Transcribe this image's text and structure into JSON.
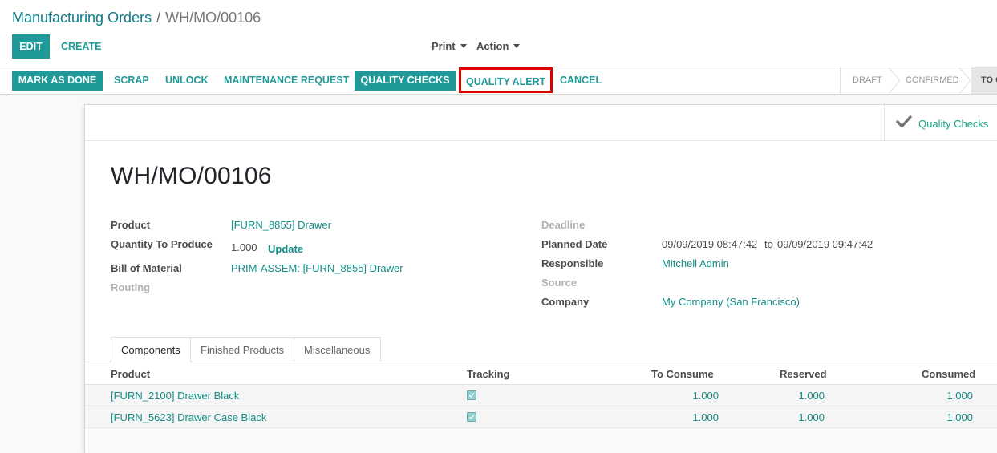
{
  "breadcrumb": {
    "parent": "Manufacturing Orders",
    "separator": "/",
    "current": "WH/MO/00106"
  },
  "toolbar": {
    "edit_label": "EDIT",
    "create_label": "CREATE",
    "print_label": "Print",
    "action_label": "Action"
  },
  "statusbar": {
    "buttons": [
      "MARK AS DONE",
      "SCRAP",
      "UNLOCK",
      "MAINTENANCE REQUEST",
      "QUALITY CHECKS",
      "QUALITY ALERT",
      "CANCEL"
    ],
    "states": [
      "DRAFT",
      "CONFIRMED",
      "TO C"
    ],
    "highlight_color": "#e00000"
  },
  "smart_button": {
    "label": "Quality Checks",
    "icon": "check-icon"
  },
  "record": {
    "title": "WH/MO/00106",
    "left_fields": {
      "product_label": "Product",
      "product_value": "[FURN_8855] Drawer",
      "qty_label": "Quantity To Produce",
      "qty_value": "1.000",
      "update_label": "Update",
      "bom_label": "Bill of Material",
      "bom_value": "PRIM-ASSEM: [FURN_8855] Drawer",
      "routing_label": "Routing"
    },
    "right_fields": {
      "deadline_label": "Deadline",
      "planned_label": "Planned Date",
      "planned_from": "09/09/2019 08:47:42",
      "planned_to_word": "to",
      "planned_to": "09/09/2019 09:47:42",
      "responsible_label": "Responsible",
      "responsible_value": "Mitchell Admin",
      "source_label": "Source",
      "company_label": "Company",
      "company_value": "My Company (San Francisco)"
    }
  },
  "tabs": [
    "Components",
    "Finished Products",
    "Miscellaneous"
  ],
  "components_table": {
    "headers": [
      "Product",
      "Tracking",
      "To Consume",
      "Reserved",
      "Consumed"
    ],
    "rows": [
      {
        "product": "[FURN_2100] Drawer Black",
        "tracking": true,
        "to_consume": "1.000",
        "reserved": "1.000",
        "consumed": "1.000"
      },
      {
        "product": "[FURN_5623] Drawer Case Black",
        "tracking": true,
        "to_consume": "1.000",
        "reserved": "1.000",
        "consumed": "1.000"
      }
    ]
  }
}
